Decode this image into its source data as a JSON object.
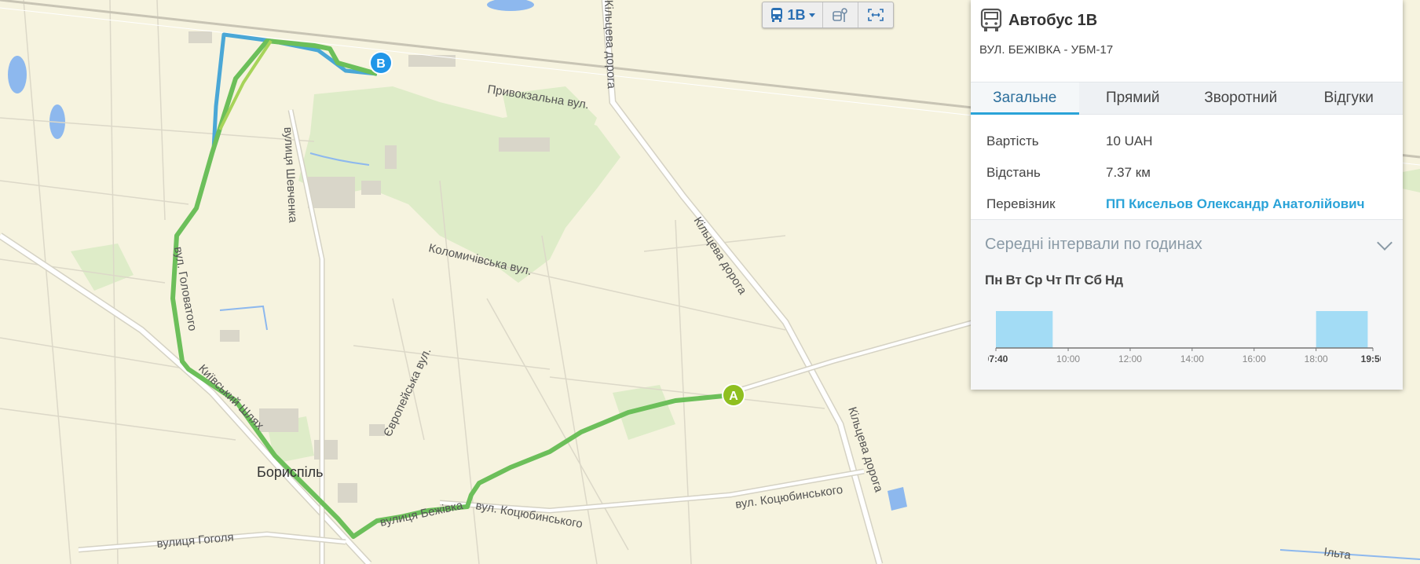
{
  "map": {
    "labels": {
      "street_pryvokzalna": "Привокзальна вул.",
      "street_shevchenka": "вулиця Шевченка",
      "street_kolomychivska": "Коломичівська вул.",
      "ring_road_1": "Кільцева дорога",
      "ring_road_2": "Кільцева дорога",
      "ring_road_3": "Кільцева дорога",
      "street_yevropeiska": "Європейська вул.",
      "street_kotsiubynskoho_1": "вул. Коцюбинського",
      "street_kotsiubynskoho_2": "вул. Коцюбинського",
      "street_hoholia": "вулиця Гоголя",
      "street_brovarska": "вул. Головатого",
      "street_kyivskyi": "Київський Шлях",
      "street_bezhivka": "вулиця Бежівка",
      "city": "Бориспіль",
      "ilta": "Ільта"
    },
    "markers": {
      "start": "A",
      "end": "B"
    },
    "route_colors": {
      "forward": "#6cbf5a",
      "backward": "#4aa7d6",
      "marker_a": "#8fbf1f",
      "marker_b": "#2196e8"
    }
  },
  "toolbar": {
    "route_label": "1В",
    "route_icon": "bus-icon",
    "stops_icon": "bus-stop-icon",
    "fit_icon": "fit-bounds-icon"
  },
  "panel": {
    "icon": "bus-icon",
    "title": "Автобус 1В",
    "subtitle": "ВУЛ. БЕЖІВКА - УБМ-17",
    "tabs": [
      "Загальне",
      "Прямий",
      "Зворотний",
      "Відгуки"
    ],
    "active_tab": "Загальне",
    "info": {
      "price_label": "Вартість",
      "price_value": "10 UAH",
      "distance_label": "Відстань",
      "distance_value": "7.37 км",
      "carrier_label": "Перевізник",
      "carrier_value": "ПП Кисельов Олександр Анатолійович"
    },
    "intervals": {
      "title": "Середні інтервали по годинах",
      "days": [
        "Пн",
        "Вт",
        "Ср",
        "Чт",
        "Пт",
        "Сб",
        "Нд"
      ]
    }
  },
  "chart_data": {
    "type": "bar",
    "x_start": "07:40",
    "x_end": "19:50",
    "ticks": [
      "07:40",
      "10:00",
      "12:00",
      "14:00",
      "16:00",
      "18:00",
      "19:50"
    ],
    "bars": [
      {
        "from": "07:40",
        "to": "09:30"
      },
      {
        "from": "18:00",
        "to": "19:40"
      }
    ],
    "color": "#a3dcf5"
  }
}
